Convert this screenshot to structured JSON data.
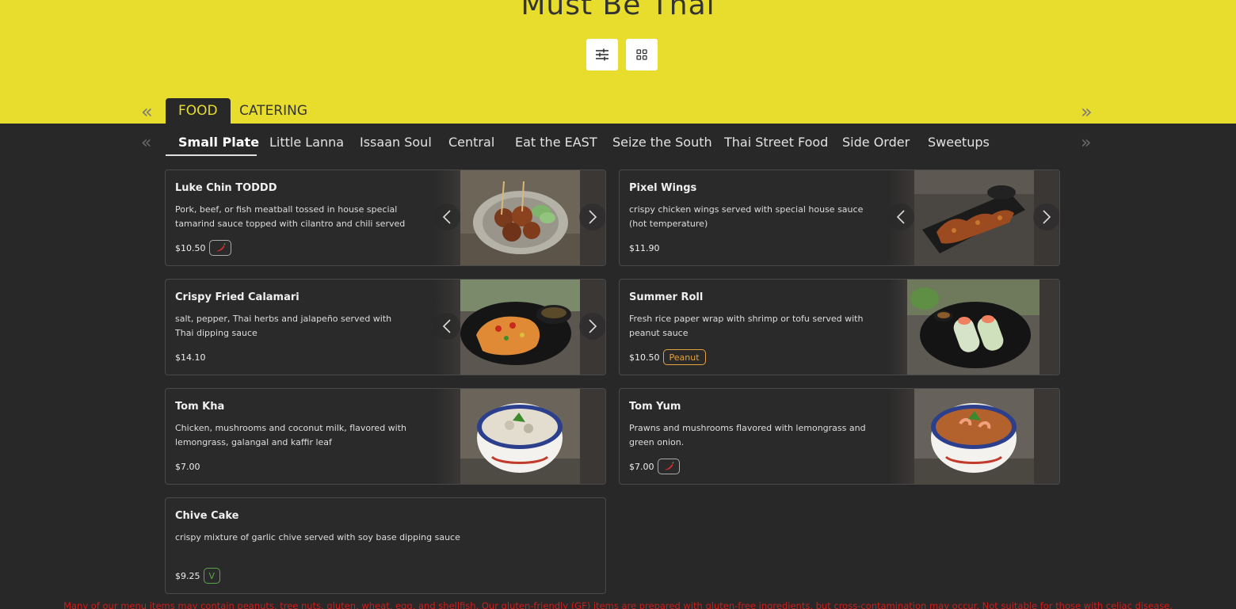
{
  "header": {
    "title": "Must Be Thai",
    "filter_icon": "sliders-icon",
    "grid_icon": "grid-icon"
  },
  "top_tabs": {
    "items": [
      {
        "label": "FOOD",
        "active": true
      },
      {
        "label": "CATERING",
        "active": false
      }
    ],
    "prev_icon": "double-chevron-left-icon",
    "next_icon": "double-chevron-right-icon"
  },
  "categories": {
    "items": [
      {
        "label": "Small Plate",
        "active": true
      },
      {
        "label": "Little Lanna"
      },
      {
        "label": "Issaan Soul"
      },
      {
        "label": "Central"
      },
      {
        "label": "Eat the EAST"
      },
      {
        "label": "Seize the South"
      },
      {
        "label": "Thai Street Food"
      },
      {
        "label": "Side Order"
      },
      {
        "label": "Sweetups"
      }
    ]
  },
  "menu": [
    {
      "name": "Luke Chin TODDD",
      "description": "Pork, beef, or fish meatball tossed in house special tamarind sauce topped with cilantro and chili served at",
      "price": "$10.50",
      "tags": [
        "spicy"
      ],
      "carousel": true
    },
    {
      "name": "Pixel Wings",
      "description": "crispy chicken wings served with special house sauce (hot temperature)",
      "price": "$11.90",
      "tags": [],
      "carousel": true
    },
    {
      "name": "Crispy Fried Calamari",
      "description": "salt, pepper, Thai herbs and jalapeño served with Thai dipping sauce",
      "price": "$14.10",
      "tags": [],
      "carousel": true
    },
    {
      "name": "Summer Roll",
      "description": "Fresh rice paper wrap with shrimp or tofu served with peanut sauce",
      "price": "$10.50",
      "tags": [
        "Peanut"
      ],
      "carousel": false
    },
    {
      "name": "Tom Kha",
      "description": "Chicken, mushrooms and coconut milk, flavored with lemongrass, galangal and kaffir leaf",
      "price": "$7.00",
      "tags": [],
      "carousel": false
    },
    {
      "name": "Tom Yum",
      "description": "Prawns and mushrooms flavored with lemongrass and green onion.",
      "price": "$7.00",
      "tags": [
        "spicy"
      ],
      "carousel": false
    },
    {
      "name": "Chive Cake",
      "description": "crispy mixture of garlic chive served with soy base dipping sauce",
      "price": "$9.25",
      "tags": [
        "V"
      ],
      "carousel": false
    }
  ],
  "disclaimer": "Many of our menu items may contain peanuts, tree nuts, gluten, wheat, egg, and shellfish. Our gluten-friendly (GF) items are prepared with gluten-free ingredients, but cross-contamination may occur. Not suitable for those with celiac disease.",
  "colors": {
    "header_bg": "#e8dd2c",
    "body_bg": "#282828",
    "accent": "#e8dd2c",
    "peanut": "#e6a23c",
    "vegetarian": "#5aa64a",
    "disclaimer": "#d11a1a"
  }
}
